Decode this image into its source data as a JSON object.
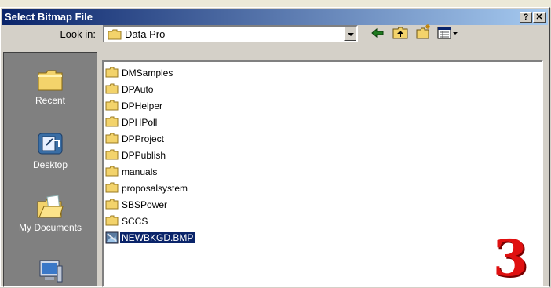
{
  "dialog": {
    "title": "Select Bitmap File",
    "help_label": "?",
    "close_label": "✕"
  },
  "lookin": {
    "label": "Look in:",
    "value": "Data Pro"
  },
  "toolbar": {
    "icons": [
      "back-arrow-icon",
      "up-one-level-icon",
      "create-new-folder-icon",
      "view-menu-icon"
    ]
  },
  "places": [
    {
      "label": "Recent",
      "icon": "recent-folder-icon"
    },
    {
      "label": "Desktop",
      "icon": "desktop-icon"
    },
    {
      "label": "My Documents",
      "icon": "my-documents-icon"
    },
    {
      "label": "",
      "icon": "my-computer-icon"
    }
  ],
  "files": [
    {
      "name": "DMSamples",
      "type": "folder"
    },
    {
      "name": "DPAuto",
      "type": "folder"
    },
    {
      "name": "DPHelper",
      "type": "folder"
    },
    {
      "name": "DPHPoll",
      "type": "folder"
    },
    {
      "name": "DPProject",
      "type": "folder"
    },
    {
      "name": "DPPublish",
      "type": "folder"
    },
    {
      "name": "manuals",
      "type": "folder"
    },
    {
      "name": "proposalsystem",
      "type": "folder"
    },
    {
      "name": "SBSPower",
      "type": "folder"
    },
    {
      "name": "SCCS",
      "type": "folder"
    },
    {
      "name": "NEWBKGD.BMP",
      "type": "bitmap",
      "selected": true
    }
  ],
  "overlay_number": "3",
  "colors": {
    "title_start": "#0a246a",
    "title_end": "#a6caf0",
    "selection": "#0a246a",
    "places_bg": "#808080",
    "folder": "#f3d36b",
    "badge": "#e01010"
  }
}
